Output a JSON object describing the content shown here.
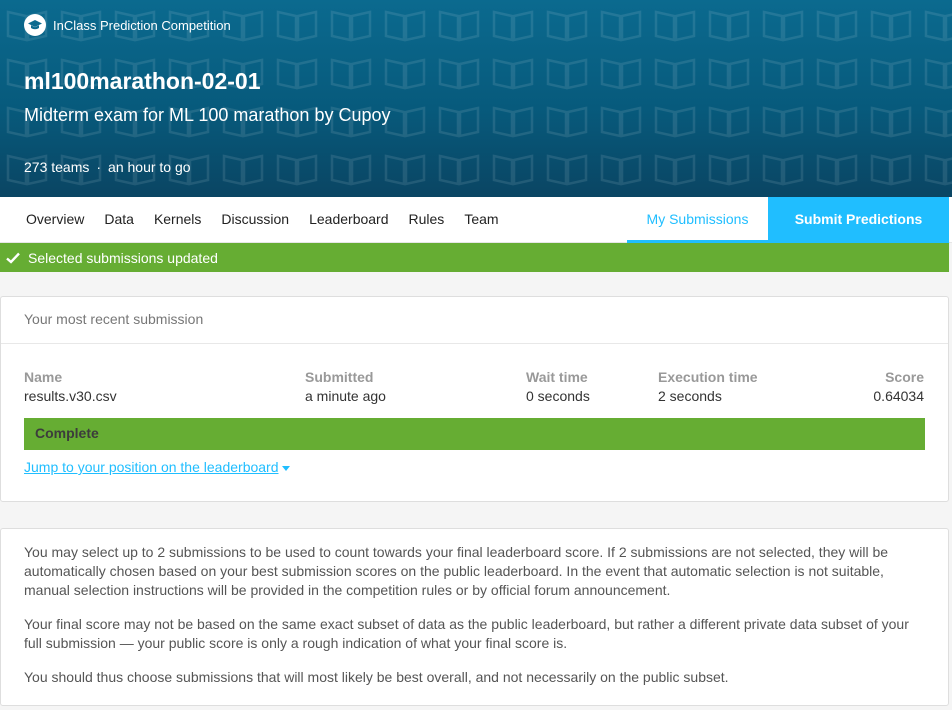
{
  "header": {
    "badge_label": "InClass Prediction Competition",
    "title": "ml100marathon-02-01",
    "subtitle": "Midterm exam for ML 100 marathon by Cupoy",
    "teams": "273 teams",
    "separator": "·",
    "deadline": "an hour to go",
    "background_color": "#075a7c",
    "pattern_icon": "book-icon"
  },
  "nav": {
    "tabs": [
      "Overview",
      "Data",
      "Kernels",
      "Discussion",
      "Leaderboard",
      "Rules",
      "Team"
    ],
    "my_submissions": "My Submissions",
    "submit_predictions": "Submit Predictions",
    "accent_color": "#20beff"
  },
  "flash": {
    "message": "Selected submissions updated",
    "icon": "checkmark-icon",
    "color": "#66ad33"
  },
  "recent_submission": {
    "heading": "Your most recent submission",
    "columns": {
      "name": {
        "label": "Name",
        "value": "results.v30.csv"
      },
      "submitted": {
        "label": "Submitted",
        "value": "a minute ago"
      },
      "wait": {
        "label": "Wait time",
        "value": "0 seconds"
      },
      "execution": {
        "label": "Execution time",
        "value": "2 seconds"
      },
      "score": {
        "label": "Score",
        "value": "0.64034"
      }
    },
    "status": "Complete",
    "jump_link": "Jump to your position on the leaderboard"
  },
  "info": {
    "p1": "You may select up to 2 submissions to be used to count towards your final leaderboard score. If 2 submissions are not selected, they will be automatically chosen based on your best submission scores on the public leaderboard. In the event that automatic selection is not suitable, manual selection instructions will be provided in the competition rules or by official forum announcement.",
    "p2": "Your final score may not be based on the same exact subset of data as the public leaderboard, but rather a different private data subset of your full submission — your public score is only a rough indication of what your final score is.",
    "p3": "You should thus choose submissions that will most likely be best overall, and not necessarily on the public subset."
  }
}
